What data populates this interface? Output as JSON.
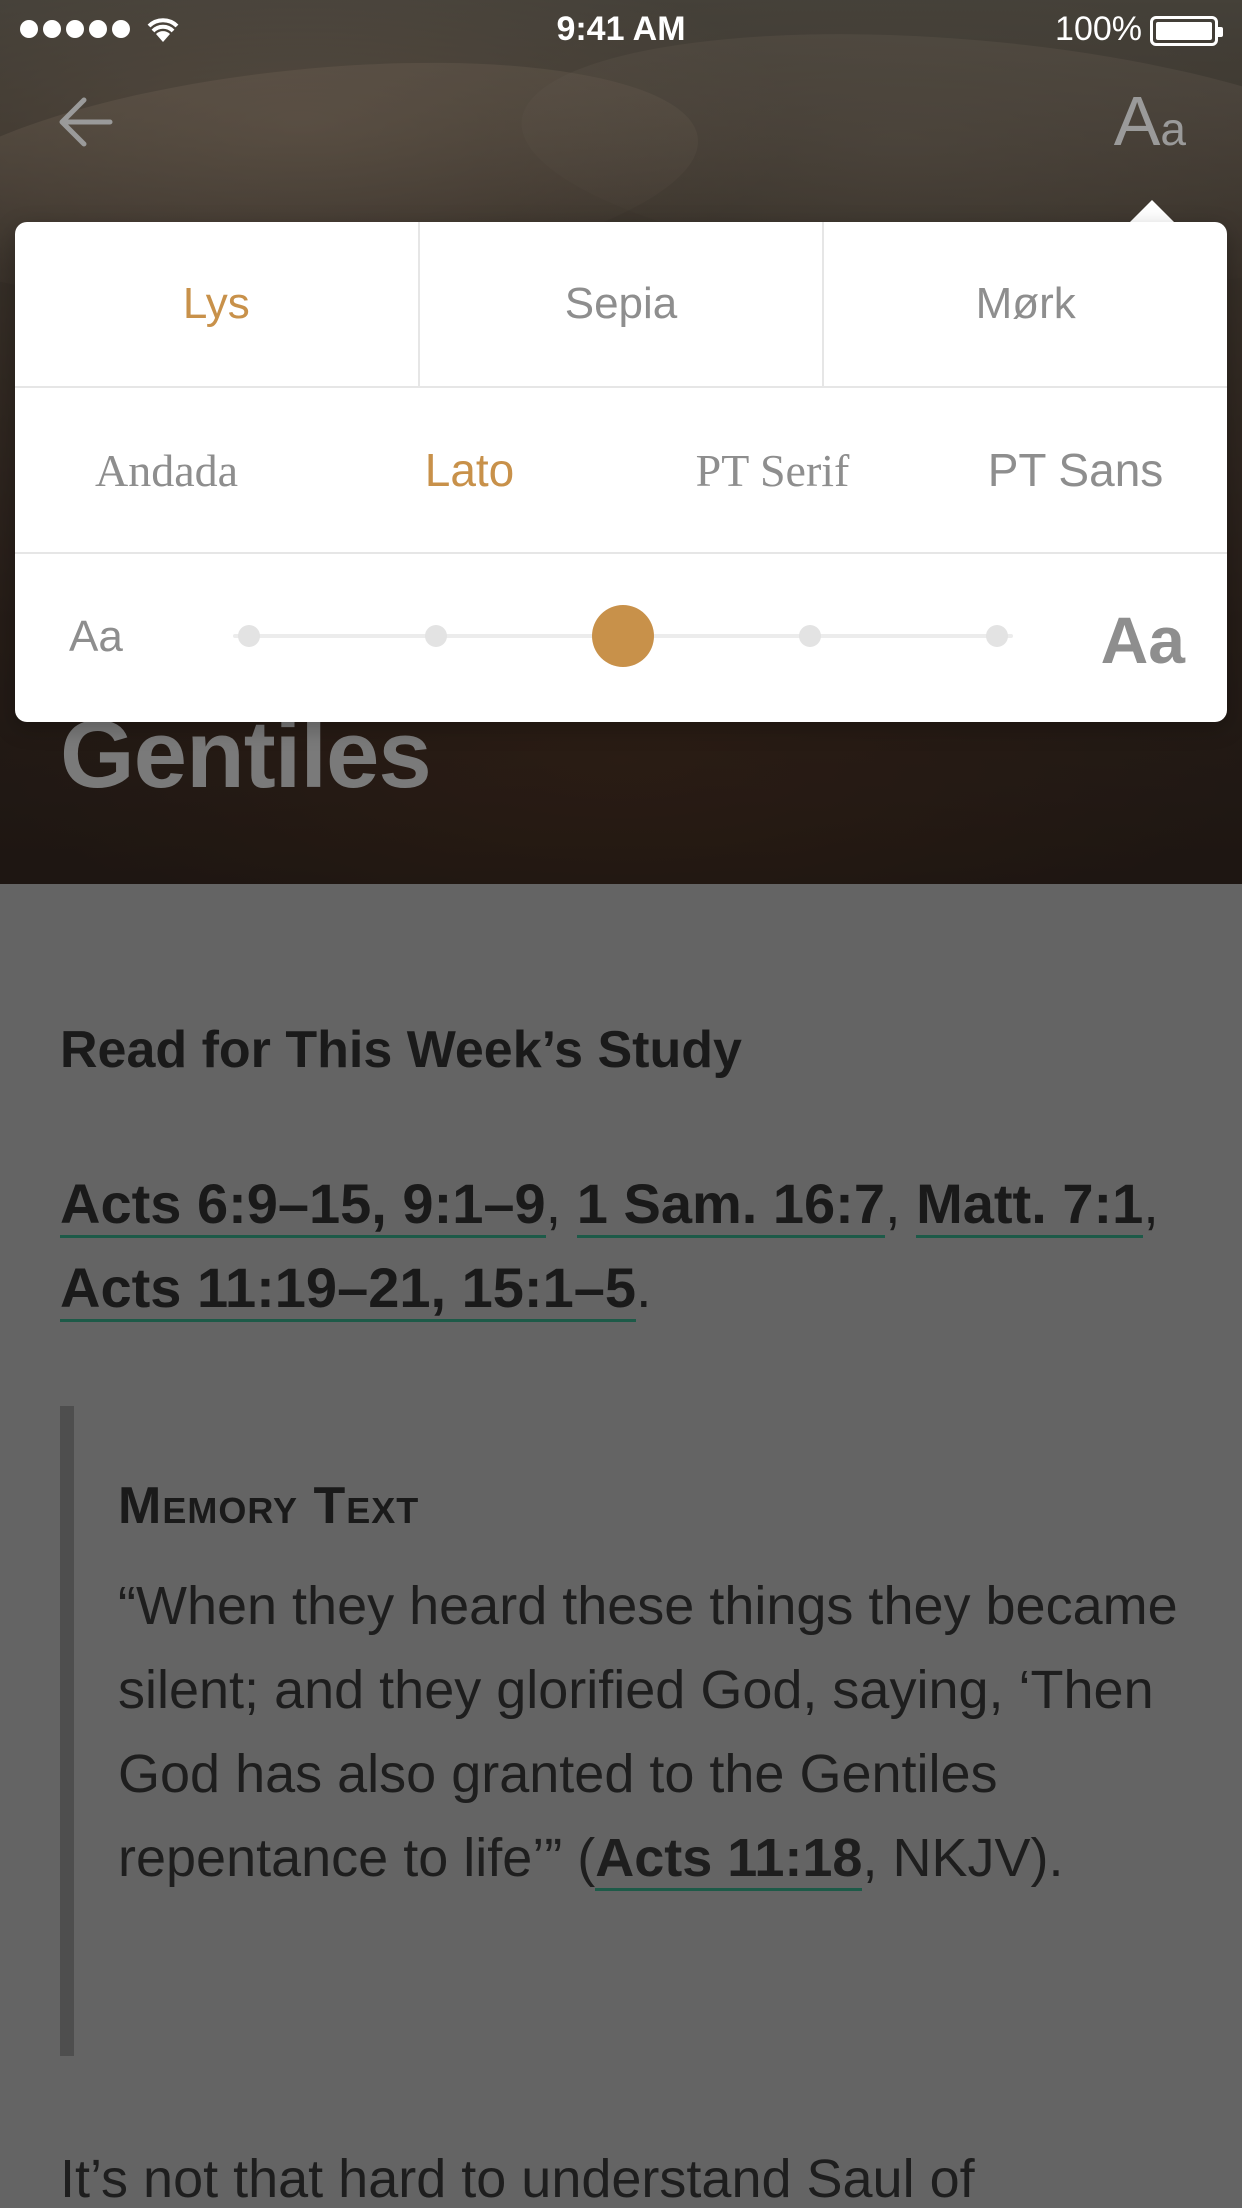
{
  "status_bar": {
    "time": "9:41 AM",
    "battery": "100%"
  },
  "nav": {
    "font_button_big": "A",
    "font_button_small": "a"
  },
  "hero": {
    "title": "Gentiles"
  },
  "popover": {
    "themes": [
      {
        "label": "Lys",
        "active": true
      },
      {
        "label": "Sepia",
        "active": false
      },
      {
        "label": "Mørk",
        "active": false
      }
    ],
    "fonts": [
      {
        "label": "Andada",
        "active": false
      },
      {
        "label": "Lato",
        "active": true
      },
      {
        "label": "PT Serif",
        "active": false
      },
      {
        "label": "PT Sans",
        "active": false
      }
    ],
    "size": {
      "small_label": "Aa",
      "large_label": "Aa",
      "steps": 5,
      "selected_index": 2
    },
    "accent_color": "#c8914a"
  },
  "content": {
    "heading": "Read for This Week’s Study",
    "readings": {
      "link1": "Acts 6:9–15, 9:1–9",
      "link2": "1 Sam. 16:7",
      "link3": "Matt. 7:1",
      "link4": "Acts 11:19–21, 15:1–5",
      "comma": ",",
      "period": "."
    },
    "memory": {
      "title": "Memory Text",
      "text_before": "“When they heard these things they became silent; and they glorified God, saying, ‘Then God has also granted to the Gentiles repentance to life’” (",
      "reference": "Acts 11:18",
      "text_after": ", NKJV)."
    },
    "body_start": "It’s not that hard to understand Saul of"
  }
}
